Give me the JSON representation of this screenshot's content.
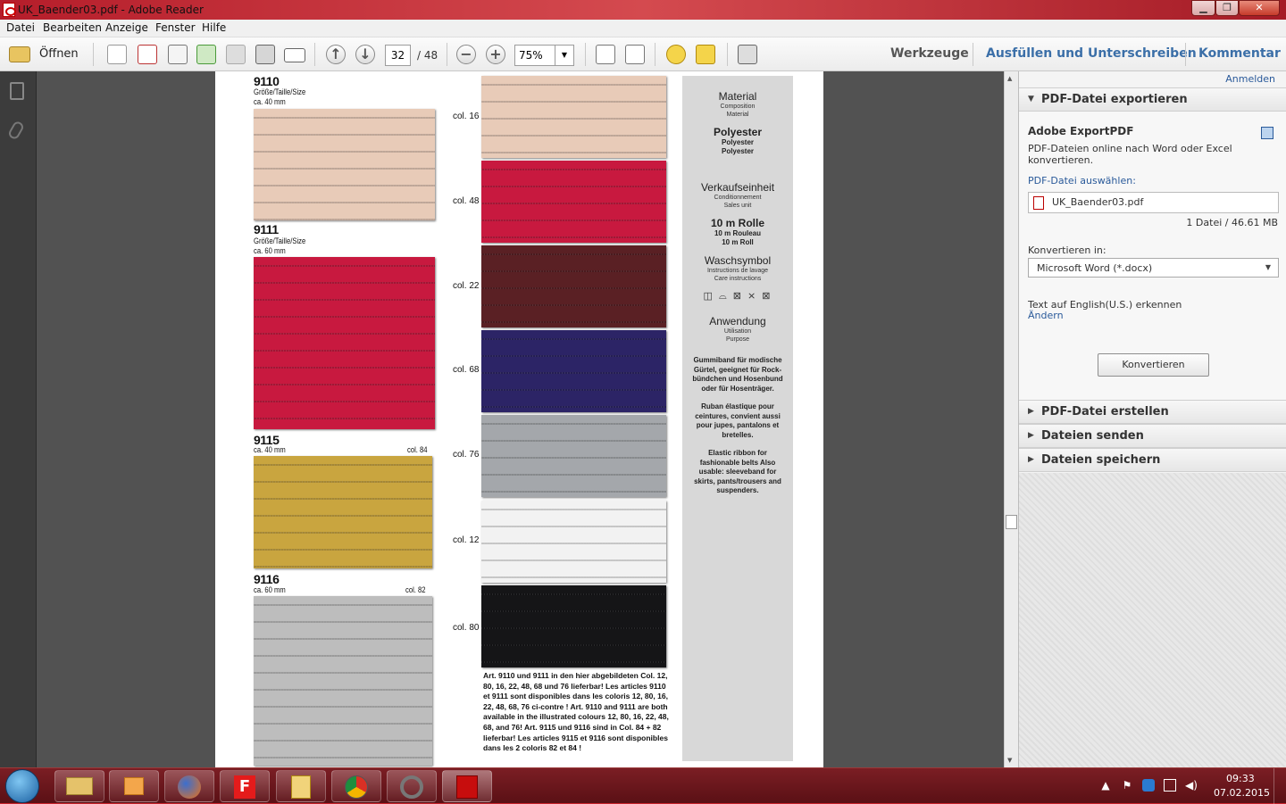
{
  "window": {
    "title": "UK_Baender03.pdf - Adobe Reader"
  },
  "menu": [
    "Datei",
    "Bearbeiten",
    "Anzeige",
    "Fenster",
    "Hilfe"
  ],
  "toolbar": {
    "open_label": "Öffnen",
    "page_current": "32",
    "page_total": "/ 48",
    "zoom": "75%",
    "tools": "Werkzeuge",
    "fill_sign": "Ausfüllen und Unterschreiben",
    "comment": "Kommentar"
  },
  "rpanel": {
    "signin": "Anmelden",
    "export_title": "PDF-Datei exportieren",
    "export_heading": "Adobe ExportPDF",
    "export_desc": "PDF-Dateien online nach Word oder Excel konvertieren.",
    "select_label": "PDF-Datei auswählen:",
    "filename": "UK_Baender03.pdf",
    "filesize": "1 Datei / 46.61 MB",
    "convert_label": "Konvertieren in:",
    "convert_option": "Microsoft Word (*.docx)",
    "ocr_text": "Text auf English(U.S.) erkennen",
    "change": "Ändern",
    "convert_button": "Konvertieren",
    "sec_create": "PDF-Datei erstellen",
    "sec_send": "Dateien senden",
    "sec_save": "Dateien speichern"
  },
  "doc": {
    "items": [
      {
        "no": "9110",
        "size_label": "Größe/Taille/Size",
        "width": "ca. 40 mm",
        "col": ""
      },
      {
        "no": "9111",
        "size_label": "Größe/Taille/Size",
        "width": "ca. 60 mm",
        "col": ""
      },
      {
        "no": "9115",
        "size_label": "",
        "width": "ca. 40 mm",
        "col": "col. 84"
      },
      {
        "no": "9116",
        "size_label": "",
        "width": "ca. 60 mm",
        "col": "col. 82"
      }
    ],
    "swatch_cols": [
      "col. 16",
      "col. 48",
      "col. 22",
      "col. 68",
      "col. 76",
      "col. 12",
      "col. 80"
    ],
    "colors": {
      "c16": "#e8cbb8",
      "c48": "#c8193f",
      "c22": "#5a2024",
      "c68": "#2c2466",
      "c76": "#a4a7ab",
      "c12": "#f2f2f2",
      "c80": "#151517",
      "c84": "#c9a53f",
      "c82": "#bdbdbd"
    },
    "info": {
      "material": "Material",
      "material_fr": "Composition",
      "material_en": "Material",
      "poly": "Polyester",
      "poly_fr": "Polyester",
      "poly_en": "Polyester",
      "unit": "Verkaufseinheit",
      "unit_fr": "Conditionnement",
      "unit_en": "Sales unit",
      "roll": "10 m Rolle",
      "roll_fr": "10 m Rouleau",
      "roll_en": "10 m Roll",
      "wash": "Waschsymbol",
      "wash_fr": "Instructions de lavage",
      "wash_en": "Care instructions",
      "wash_icons": "◫ ⌓ ⊠ ⨯ ⊠",
      "use": "Anwendung",
      "use_fr": "Utilisation",
      "use_en": "Purpose",
      "desc_de": "Gummiband für modische Gürtel, geeignet für Rock-bündchen und Hosenbund oder für Hosenträger.",
      "desc_fr": "Ruban élastique pour ceintures, convient aussi pour jupes, pantalons et bretelles.",
      "desc_en": "Elastic ribbon for fashionable belts Also usable: sleeveband for skirts, pants/trousers and suspenders."
    },
    "notes": "Art. 9110 und 9111 in den hier abgebildeten Col. 12, 80, 16, 22, 48, 68 und 76 lieferbar! Les articles 9110 et 9111 sont disponibles dans les coloris 12, 80, 16, 22, 48, 68, 76 ci-contre ! Art. 9110 and 9111 are both available in the illustrated colours 12, 80, 16, 22, 48, 68, and 76! Art. 9115 und 9116 sind in Col. 84 + 82 lieferbar! Les articles 9115 et 9116 sont disponibles dans les 2 coloris 82 et 84 !"
  },
  "taskbar": {
    "time": "09:33",
    "date": "07.02.2015"
  }
}
